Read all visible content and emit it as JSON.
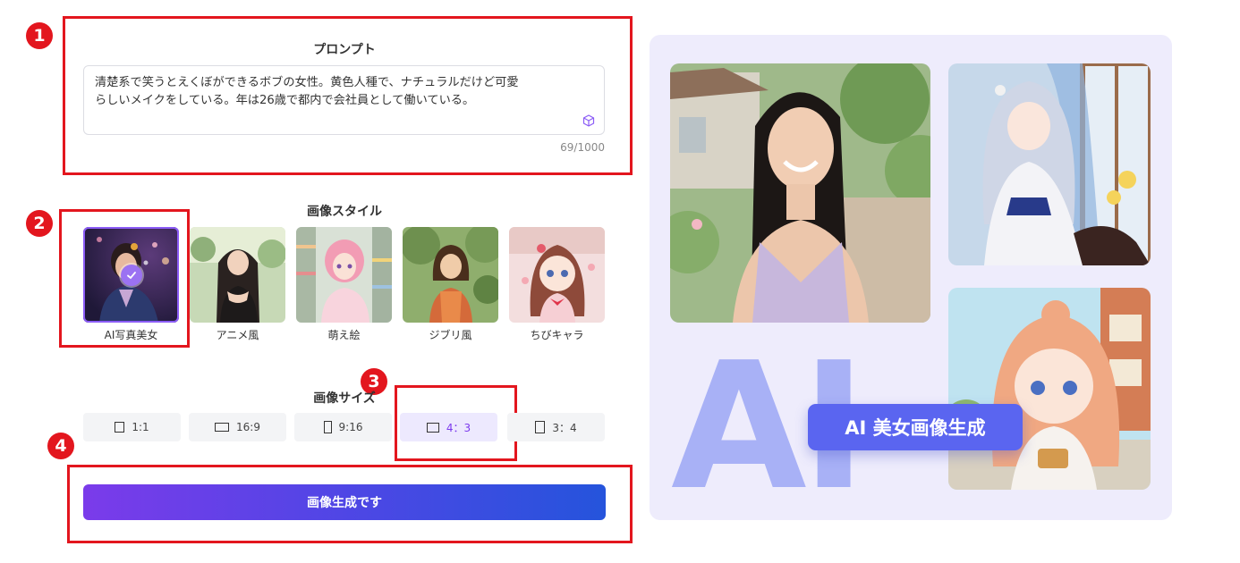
{
  "prompt": {
    "title": "プロンプト",
    "text": "清楚系で笑うとえくぼができるボブの女性。黄色人種で、ナチュラルだけど可愛\nらしいメイクをしている。年は26歳で都内で会社員として働いている。",
    "counter": "69/1000"
  },
  "styles": {
    "title": "画像スタイル",
    "items": [
      {
        "label": "AI写真美女",
        "selected": true
      },
      {
        "label": "アニメ風",
        "selected": false
      },
      {
        "label": "萌え絵",
        "selected": false
      },
      {
        "label": "ジブリ風",
        "selected": false
      },
      {
        "label": "ちびキャラ",
        "selected": false
      }
    ]
  },
  "size": {
    "title": "画像サイズ",
    "options": [
      {
        "label": "1:1",
        "active": false
      },
      {
        "label": "16:9",
        "active": false
      },
      {
        "label": "9:16",
        "active": false
      },
      {
        "label": "4：3",
        "active": true
      },
      {
        "label": "3：4",
        "active": false
      }
    ]
  },
  "generate": {
    "label": "画像生成です"
  },
  "badges": [
    "1",
    "2",
    "3",
    "4"
  ],
  "banner": {
    "big_text": "AI",
    "pill_text": "AI 美女画像生成"
  },
  "colors": {
    "annotation_red": "#e3161e",
    "accent_purple": "#7c3aed",
    "panel_bg": "#eeecfc"
  }
}
